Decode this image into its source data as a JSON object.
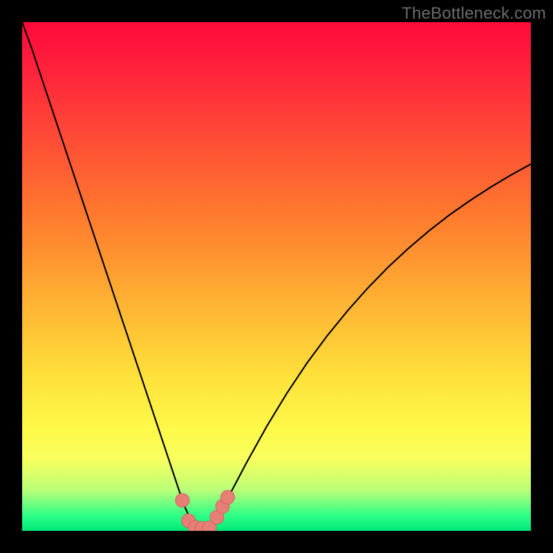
{
  "watermark": "TheBottleneck.com",
  "colors": {
    "curve": "#000000",
    "marker_fill": "#e77f76",
    "marker_stroke": "#d66058"
  },
  "chart_data": {
    "type": "line",
    "title": "",
    "xlabel": "",
    "ylabel": "",
    "xlim": [
      0,
      100
    ],
    "ylim": [
      0,
      100
    ],
    "curve": {
      "x": [
        0,
        2,
        4,
        6,
        8,
        10,
        12,
        14,
        16,
        18,
        20,
        22,
        24,
        26,
        28,
        30,
        31,
        32,
        33,
        34,
        35,
        36,
        37,
        38,
        39,
        40,
        42,
        44,
        48,
        52,
        56,
        60,
        64,
        68,
        72,
        76,
        80,
        84,
        88,
        92,
        96,
        100
      ],
      "y": [
        100,
        94.5,
        88.5,
        82.5,
        76.5,
        70.5,
        64.5,
        58.5,
        52.5,
        46.5,
        40.5,
        34.5,
        28.5,
        22.5,
        16.5,
        10.5,
        7.5,
        4.7,
        2.4,
        1.0,
        0.3,
        0.3,
        1.0,
        2.2,
        3.8,
        5.6,
        9.4,
        13.2,
        20.4,
        27.0,
        33.0,
        38.4,
        43.3,
        47.8,
        51.9,
        55.6,
        59.0,
        62.1,
        64.9,
        67.5,
        69.9,
        72.1
      ]
    },
    "markers": [
      {
        "x": 31.5,
        "y": 6.0
      },
      {
        "x": 32.7,
        "y": 2.0
      },
      {
        "x": 34.0,
        "y": 0.7
      },
      {
        "x": 35.4,
        "y": 0.5
      },
      {
        "x": 36.8,
        "y": 0.6
      },
      {
        "x": 38.3,
        "y": 2.7
      },
      {
        "x": 39.4,
        "y": 4.8
      },
      {
        "x": 40.4,
        "y": 6.6
      }
    ]
  }
}
